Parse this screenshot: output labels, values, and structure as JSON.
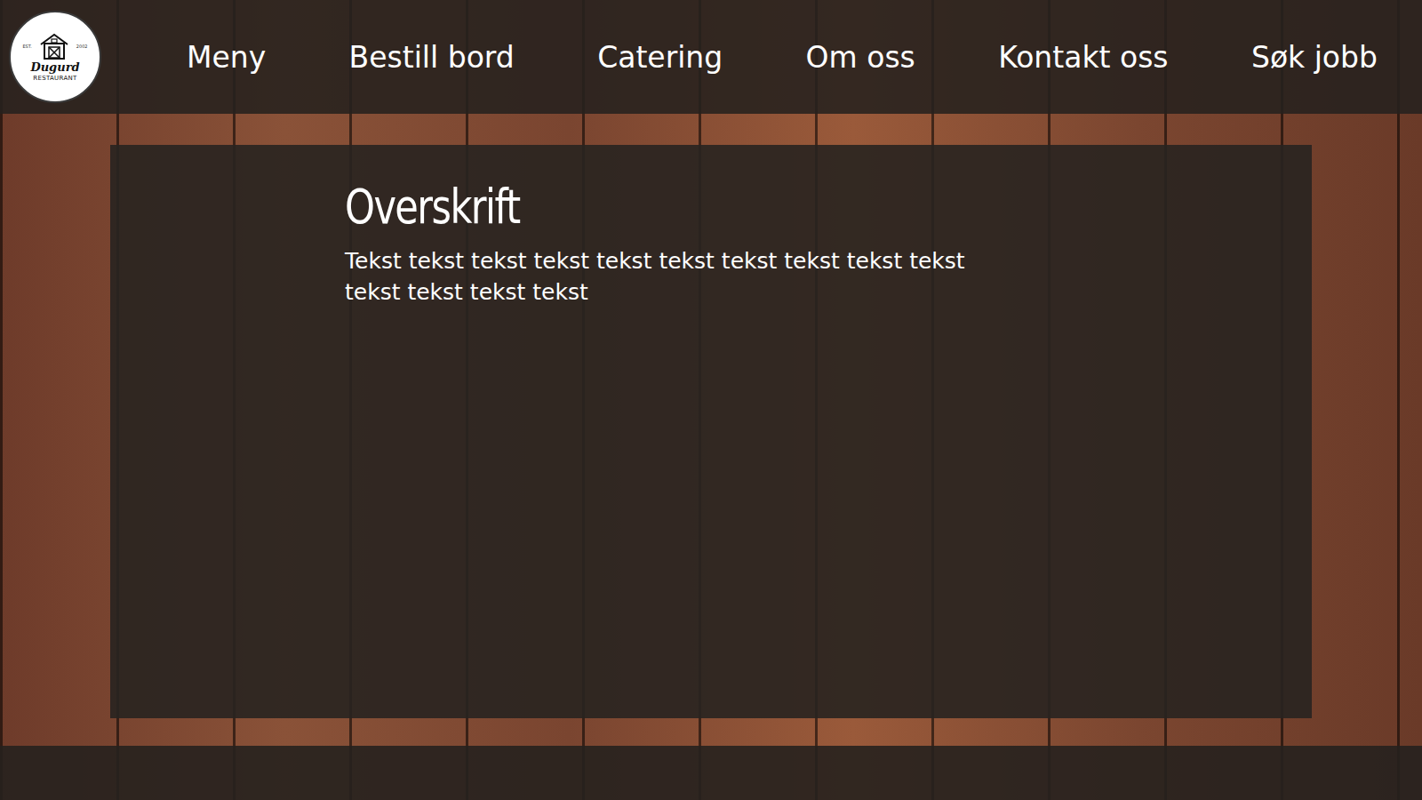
{
  "logo": {
    "name": "Dugurd",
    "subtitle": "RESTAURANT",
    "est": "EST.",
    "year": "2002"
  },
  "nav": [
    {
      "label": "Meny"
    },
    {
      "label": "Bestill bord"
    },
    {
      "label": "Catering"
    },
    {
      "label": "Om oss"
    },
    {
      "label": "Kontakt oss"
    },
    {
      "label": "Søk jobb"
    }
  ],
  "content": {
    "heading": "Overskrift",
    "body": "Tekst tekst tekst tekst tekst tekst tekst tekst tekst tekst tekst tekst tekst tekst"
  }
}
